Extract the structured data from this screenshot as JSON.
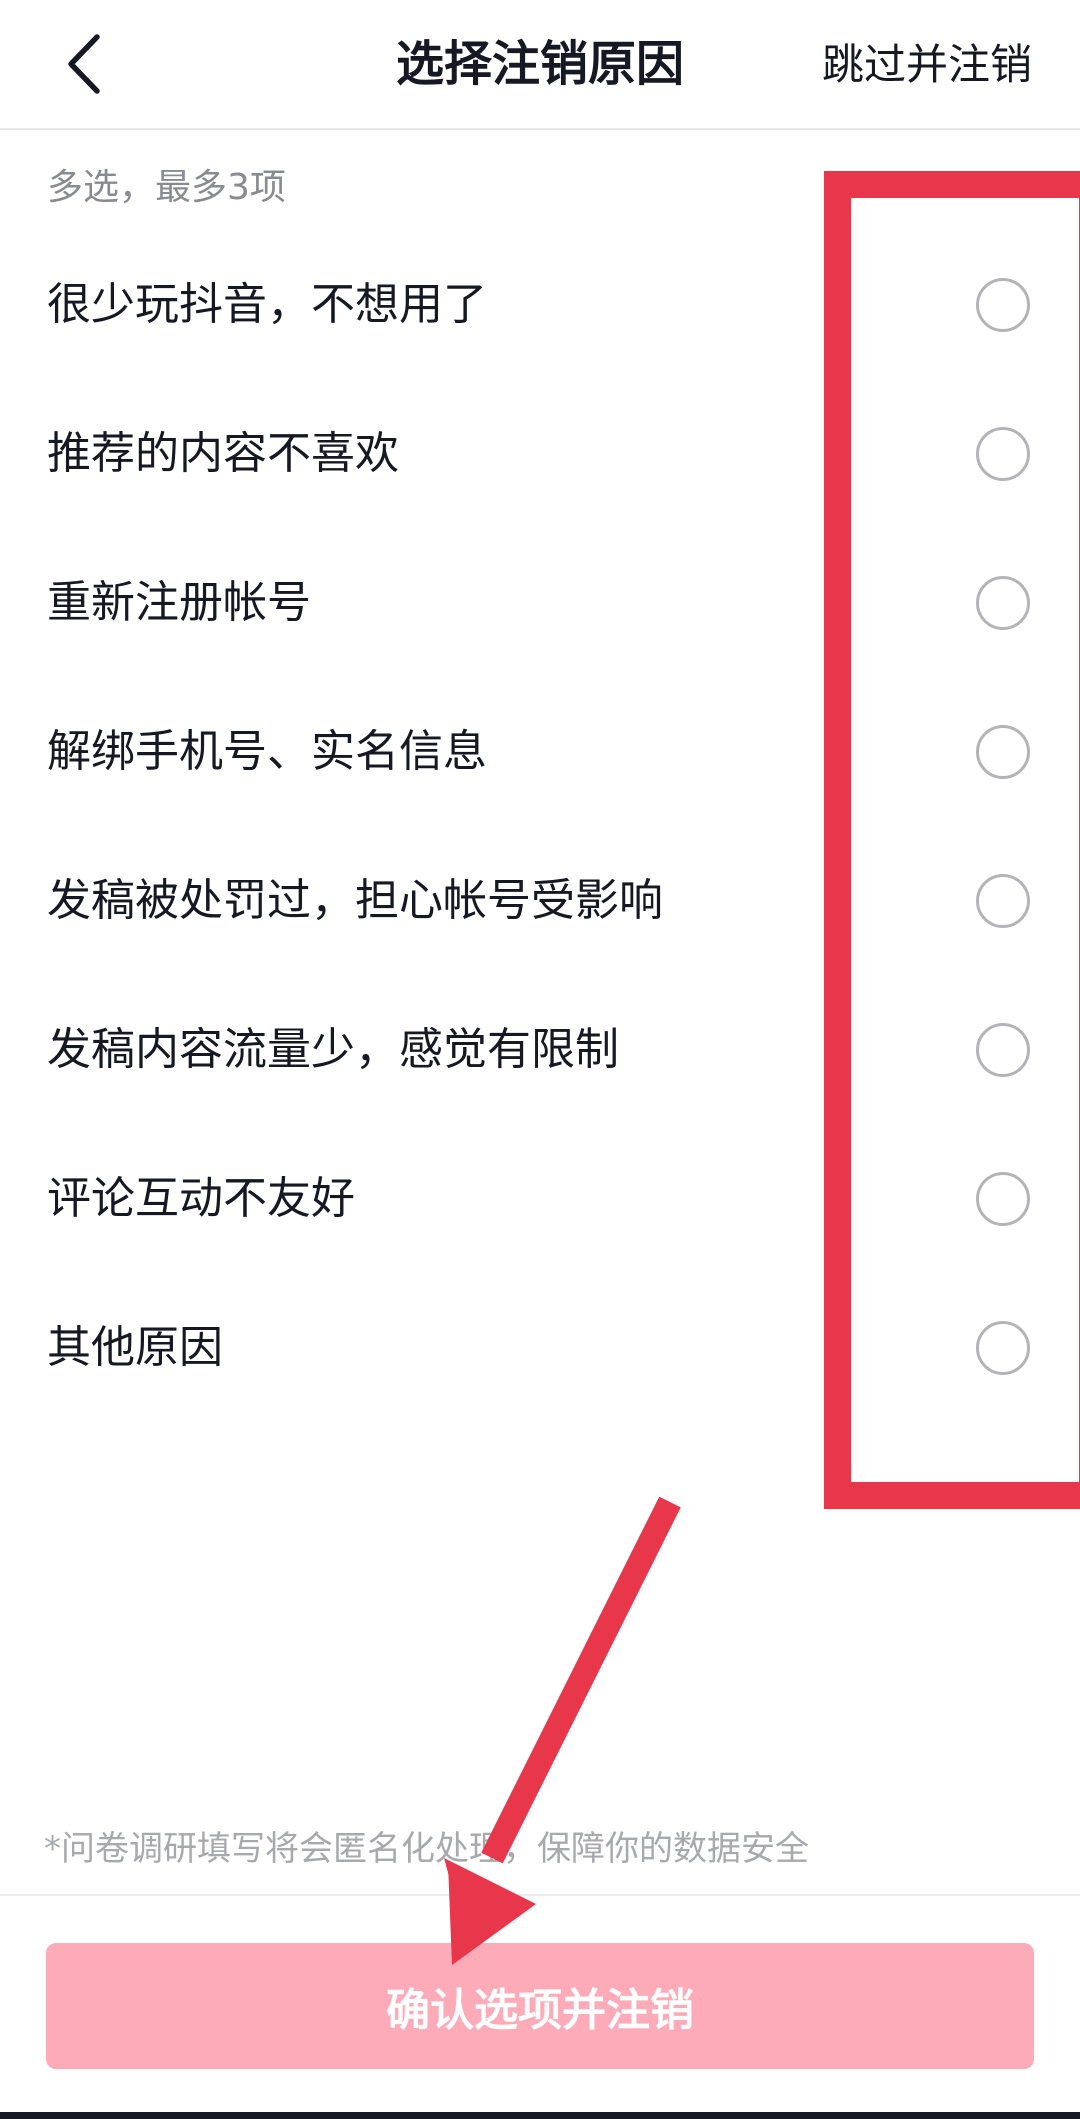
{
  "header": {
    "title": "选择注销原因",
    "skip_label": "跳过并注销"
  },
  "hint": "多选，最多3项",
  "options": [
    {
      "label": "很少玩抖音，不想用了",
      "selected": false
    },
    {
      "label": "推荐的内容不喜欢",
      "selected": false
    },
    {
      "label": "重新注册帐号",
      "selected": false
    },
    {
      "label": "解绑手机号、实名信息",
      "selected": false
    },
    {
      "label": "发稿被处罚过，担心帐号受影响",
      "selected": false
    },
    {
      "label": "发稿内容流量少，感觉有限制",
      "selected": false
    },
    {
      "label": "评论互动不友好",
      "selected": false
    },
    {
      "label": "其他原因",
      "selected": false
    }
  ],
  "notice": "*问卷调研填写将会匿名化处理，保障你的数据安全",
  "confirm_label": "确认选项并注销",
  "colors": {
    "annotation": "#e8364b",
    "confirm_disabled": "#fdabb8",
    "radio_border": "#b4b4b8",
    "hint_text": "#8a8b91"
  }
}
